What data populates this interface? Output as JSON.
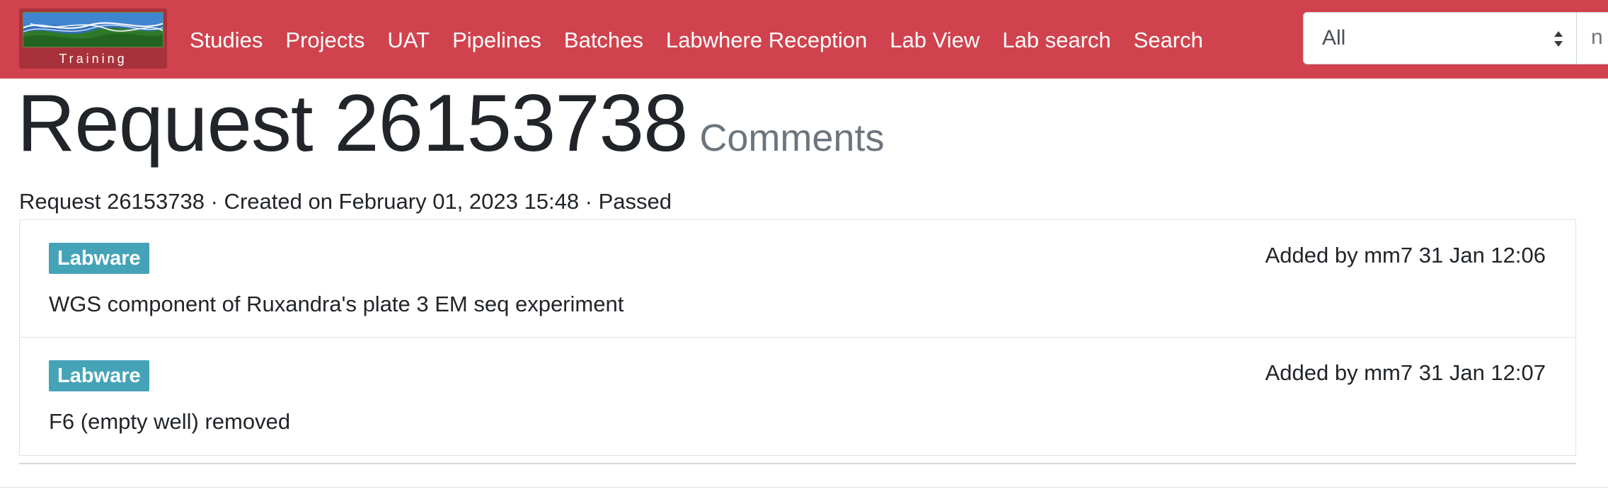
{
  "navbar": {
    "brand_label": "Training",
    "links": [
      "Studies",
      "Projects",
      "UAT",
      "Pipelines",
      "Batches",
      "Labwhere Reception",
      "Lab View",
      "Lab search",
      "Search"
    ],
    "search_select_value": "All",
    "search_input_text": "n",
    "color": "#d0434e"
  },
  "page": {
    "title": "Request 26153738",
    "subtitle": "Comments",
    "meta": "Request 26153738 · Created on February 01, 2023 15:48 · Passed"
  },
  "comments": [
    {
      "badge": "Labware",
      "added": "Added by mm7 31 Jan 12:06",
      "text": "WGS component of Ruxandra's plate 3 EM seq experiment"
    },
    {
      "badge": "Labware",
      "added": "Added by mm7 31 Jan 12:07",
      "text": "F6 (empty well) removed"
    }
  ],
  "colors": {
    "badge": "#45a3b8",
    "subtitle": "#6c757d"
  }
}
